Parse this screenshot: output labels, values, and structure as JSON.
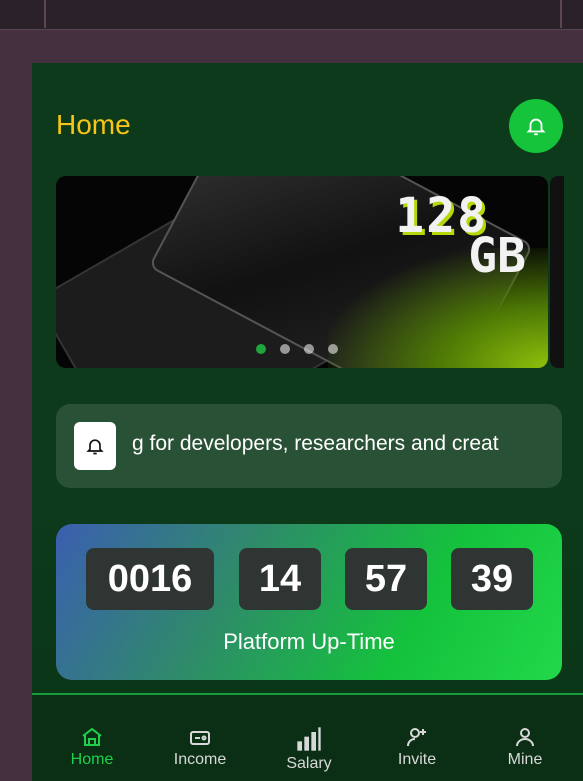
{
  "header": {
    "title": "Home"
  },
  "banner": {
    "line1": "128",
    "line2": "GB",
    "dots": 4,
    "active_dot": 0
  },
  "notice": {
    "text": "g for developers, researchers and creat"
  },
  "uptime": {
    "days": "0016",
    "hours": "14",
    "minutes": "57",
    "seconds": "39",
    "label": "Platform Up-Time"
  },
  "nav": {
    "home": "Home",
    "income": "Income",
    "salary": "Salary",
    "invite": "Invite",
    "mine": "Mine"
  },
  "colors": {
    "accent": "#1fd04c",
    "title": "#f5c518"
  }
}
